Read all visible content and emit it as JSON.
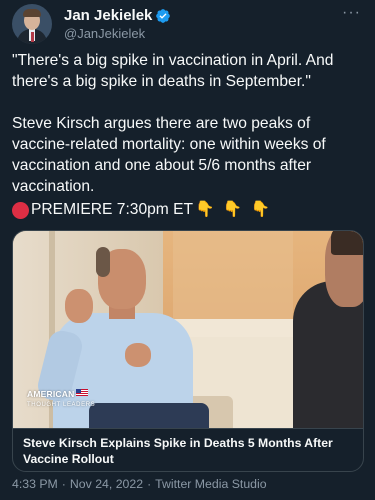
{
  "author": {
    "display_name": "Jan Jekielek",
    "handle": "@JanJekielek",
    "verified_icon": "verified-badge-icon"
  },
  "menu_icon": "more-horizontal-icon",
  "tweet": {
    "paragraph_1": "\"There's a big spike in vaccination in April. And there's a big spike in deaths in September.\"",
    "paragraph_2": "Steve Kirsch argues there are two peaks of vaccine-related mortality: one within weeks of vaccination and one about 5/6 months after vaccination.",
    "premiere_icon": "red-circle-icon",
    "premiere_text": "PREMIERE 7:30pm ET",
    "premiere_emoji": "👇 👇 👇"
  },
  "media_card": {
    "watermark_line_1": "AMERICAN",
    "watermark_line_2": "THOUGHT LEADERS",
    "caption": "Steve Kirsch Explains Spike in Deaths 5 Months After Vaccine Rollout"
  },
  "meta": {
    "time": "4:33 PM",
    "date": "Nov 24, 2022",
    "source": "Twitter Media Studio",
    "separator": "·"
  },
  "colors": {
    "background": "#15202b",
    "text": "#f7f9f9",
    "secondary": "#8b98a5",
    "verified": "#1d9bf0",
    "border": "#38444d"
  }
}
